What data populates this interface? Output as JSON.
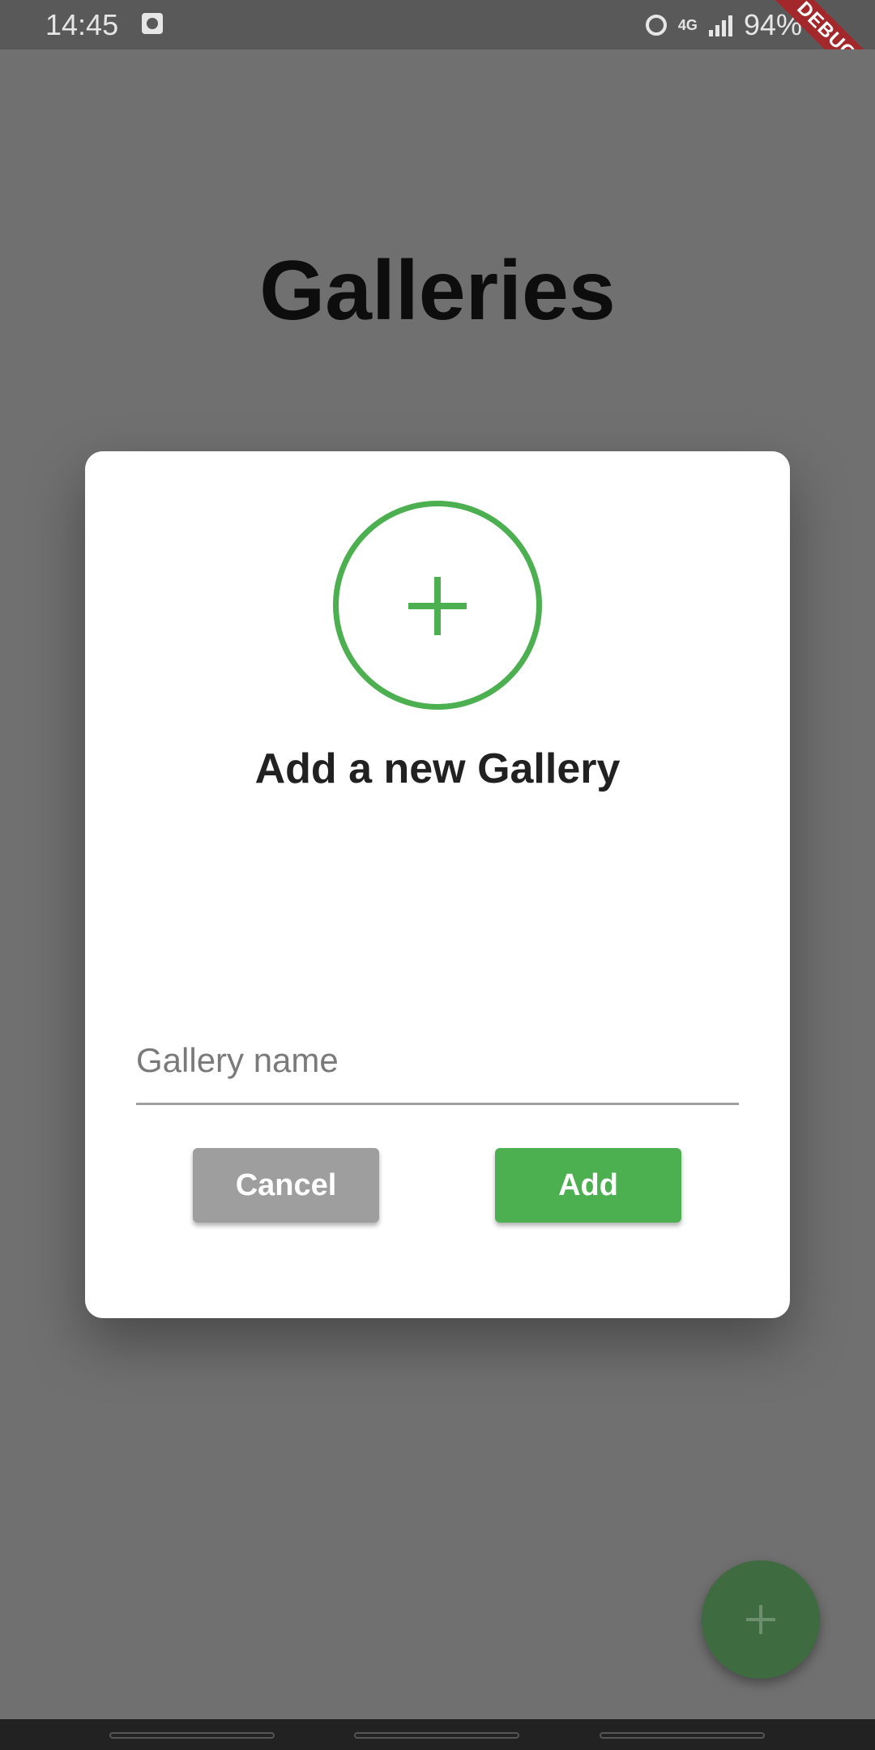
{
  "status_bar": {
    "time": "14:45",
    "network": "4G",
    "battery": "94%",
    "debug_label": "DEBUG"
  },
  "page": {
    "title": "Galleries"
  },
  "dialog": {
    "icon": "add-circle-icon",
    "title": "Add a new Gallery",
    "input": {
      "placeholder": "Gallery name",
      "value": ""
    },
    "cancel_label": "Cancel",
    "add_label": "Add"
  },
  "fab": {
    "icon": "plus-icon"
  },
  "colors": {
    "accent": "#4caf50",
    "cancel": "#9e9e9e",
    "scrim": "#707070"
  }
}
